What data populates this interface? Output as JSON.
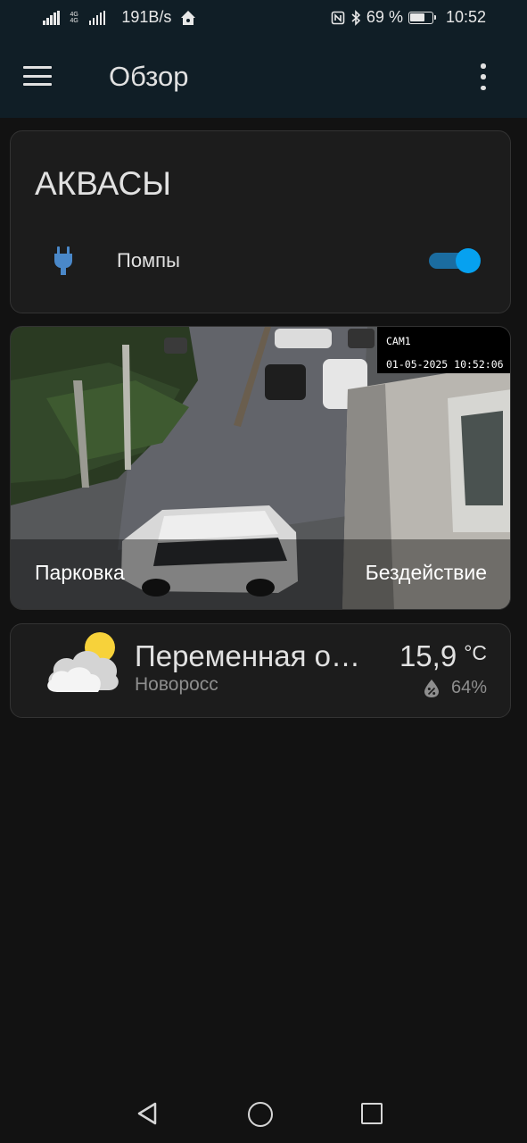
{
  "status_bar": {
    "network_type": "4G",
    "network_sub": "4G",
    "speed": "191B/s",
    "battery_text": "69 %",
    "battery_level": 0.69,
    "time": "10:52",
    "icons": [
      "signal-icon",
      "signal-icon",
      "home-assistant-icon",
      "nfc-icon",
      "bluetooth-icon",
      "battery-icon"
    ]
  },
  "app_bar": {
    "title": "Обзор"
  },
  "entities_card": {
    "title": "АКВАСЫ",
    "rows": [
      {
        "name": "Помпы",
        "icon": "power-plug-icon",
        "state": "on"
      }
    ],
    "accent": "#06a1f0"
  },
  "camera_card": {
    "osd_label": "CAM1",
    "osd_datetime": "01-05-2025 10:52:06",
    "name": "Парковка",
    "state": "Бездействие"
  },
  "weather_card": {
    "condition": "Переменная облачность",
    "location": "Новоросс",
    "temperature": "15,9",
    "unit": "°C",
    "humidity": "64%",
    "icon": "partly-cloudy-icon"
  }
}
